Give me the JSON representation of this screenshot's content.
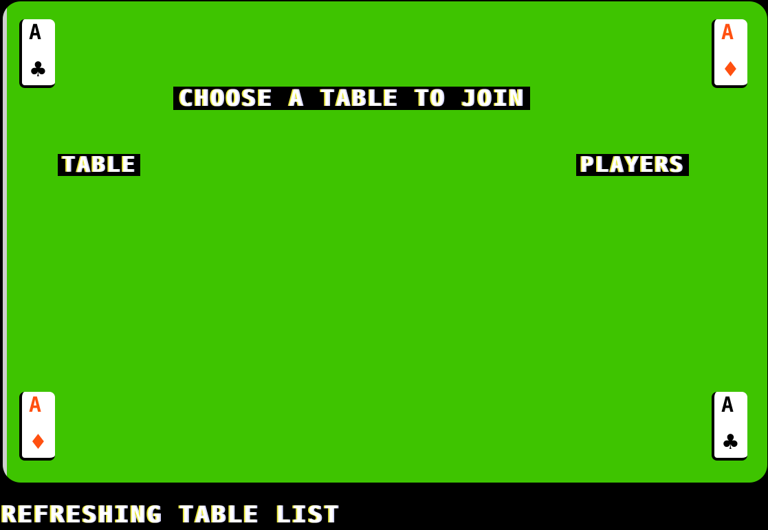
{
  "screen": {
    "title": "CHOOSE A TABLE TO JOIN",
    "columns": {
      "table": "TABLE",
      "players": "PLAYERS"
    },
    "tables": [],
    "status": "REFRESHING TABLE LIST"
  },
  "cards": {
    "top_left": {
      "rank": "A",
      "suit": "♣",
      "suit_name": "clubs-icon"
    },
    "top_right": {
      "rank": "A",
      "suit": "♦",
      "suit_name": "diamond-icon"
    },
    "bottom_left": {
      "rank": "A",
      "suit": "♦",
      "suit_name": "diamond-icon"
    },
    "bottom_right": {
      "rank": "A",
      "suit": "♣",
      "suit_name": "clubs-icon"
    }
  },
  "colors": {
    "felt": "#3ec400",
    "background": "#000000",
    "text": "#ffffff",
    "red_suit": "#ff5010"
  }
}
